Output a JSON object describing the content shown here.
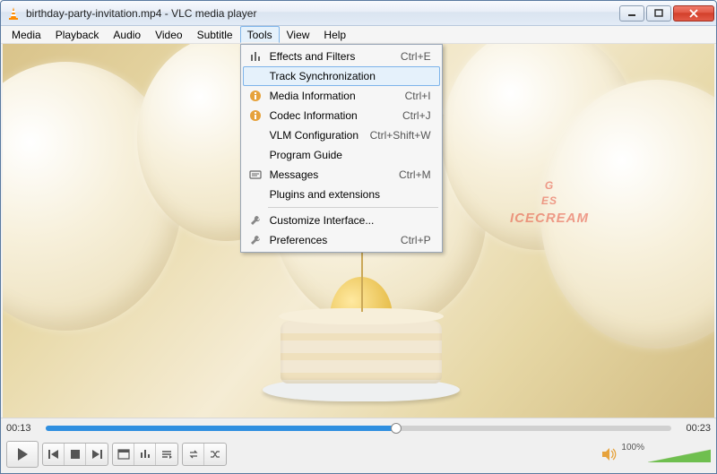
{
  "window": {
    "title": "birthday-party-invitation.mp4 - VLC media player"
  },
  "menubar": {
    "items": [
      "Media",
      "Playback",
      "Audio",
      "Video",
      "Subtitle",
      "Tools",
      "View",
      "Help"
    ],
    "open_index": 5
  },
  "tools_menu": {
    "items": [
      {
        "icon": "effects",
        "label": "Effects and Filters",
        "shortcut": "Ctrl+E"
      },
      {
        "icon": "",
        "label": "Track Synchronization",
        "shortcut": "",
        "highlight": true
      },
      {
        "icon": "info",
        "label": "Media Information",
        "shortcut": "Ctrl+I"
      },
      {
        "icon": "info",
        "label": "Codec Information",
        "shortcut": "Ctrl+J"
      },
      {
        "icon": "",
        "label": "VLM Configuration",
        "shortcut": "Ctrl+Shift+W"
      },
      {
        "icon": "",
        "label": "Program Guide",
        "shortcut": ""
      },
      {
        "icon": "messages",
        "label": "Messages",
        "shortcut": "Ctrl+M"
      },
      {
        "icon": "",
        "label": "Plugins and extensions",
        "shortcut": ""
      }
    ],
    "items2": [
      {
        "icon": "wrench",
        "label": "Customize Interface...",
        "shortcut": ""
      },
      {
        "icon": "wrench",
        "label": "Preferences",
        "shortcut": "Ctrl+P"
      }
    ]
  },
  "overlay": {
    "line1": "G",
    "line2": "ES",
    "line3": "ICECREAM"
  },
  "playback": {
    "elapsed": "00:13",
    "total": "00:23",
    "progress_pct": 56,
    "volume_label": "100%"
  },
  "colors": {
    "accent": "#2f8fe0",
    "cone": "#ff8c00"
  }
}
